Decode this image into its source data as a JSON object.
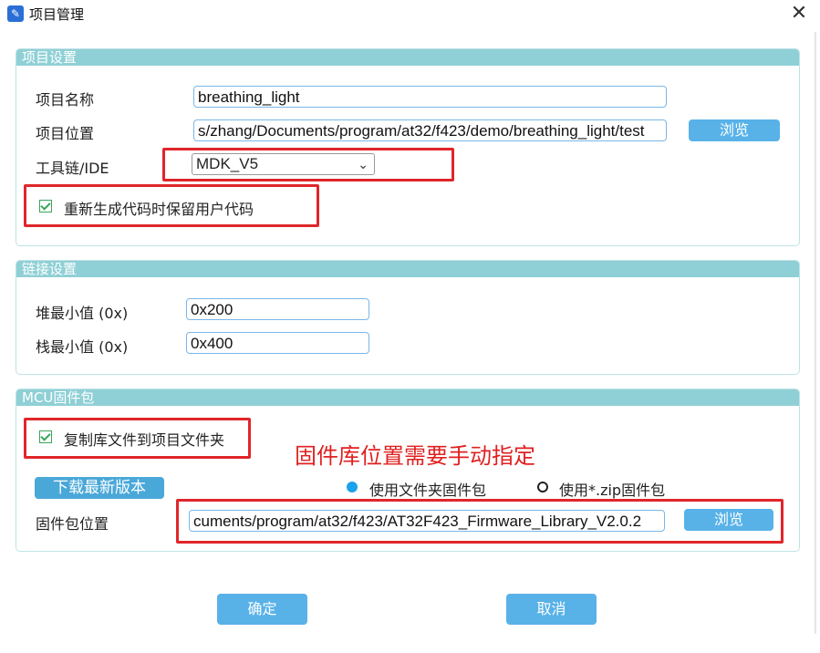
{
  "window": {
    "title": "项目管理",
    "close_glyph": "✕"
  },
  "project_settings": {
    "header": "项目设置",
    "name_label": "项目名称",
    "name_value": "breathing_light",
    "location_label": "项目位置",
    "location_value": "s/zhang/Documents/program/at32/f423/demo/breathing_light/test",
    "browse_label": "浏览",
    "toolchain_label": "工具链/IDE",
    "toolchain_value": "MDK_V5",
    "keep_user_code_label": "重新生成代码时保留用户代码"
  },
  "link_settings": {
    "header": "链接设置",
    "heap_label": "堆最小值 (0x)",
    "heap_value": "0x200",
    "stack_label": "栈最小值 (0x)",
    "stack_value": "0x400"
  },
  "firmware": {
    "header": "MCU固件包",
    "copy_lib_label": "复制库文件到项目文件夹",
    "download_label": "下载最新版本",
    "radio_folder_label": "使用文件夹固件包",
    "radio_zip_label": "使用*.zip固件包",
    "location_label": "固件包位置",
    "location_value": "cuments/program/at32/f423/AT32F423_Firmware_Library_V2.0.2",
    "browse_label": "浏览"
  },
  "annotation_text": "固件库位置需要手动指定",
  "footer": {
    "ok_label": "确定",
    "cancel_label": "取消"
  },
  "colors": {
    "group_header": "#8fd0d6",
    "button": "#58b2e8",
    "highlight": "#e0262a",
    "radio_selected": "#1aa2ea"
  }
}
